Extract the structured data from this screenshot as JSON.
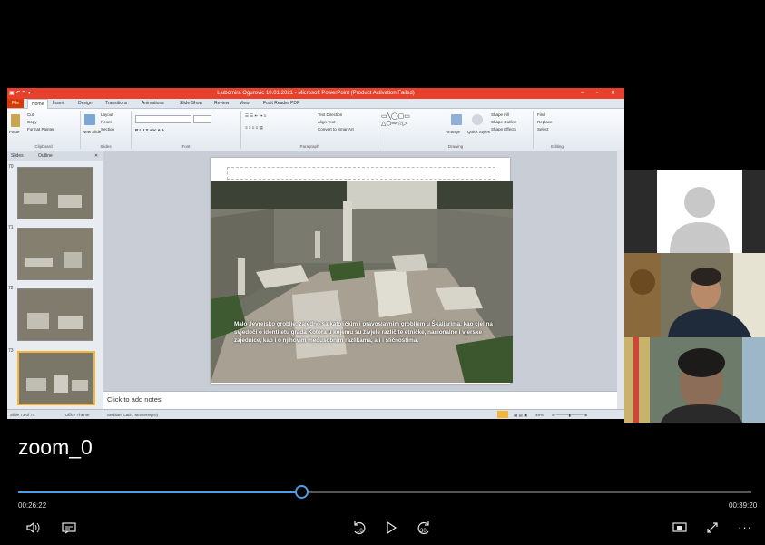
{
  "shared_screen": {
    "window_title": "Ljubomira Ogurovic 10.01.2021 - Microsoft PowerPoint (Product Activation Failed)",
    "ribbon_tabs": [
      "File",
      "Home",
      "Insert",
      "Design",
      "Transitions",
      "Animations",
      "Slide Show",
      "Review",
      "View",
      "Foxit Reader PDF"
    ],
    "clipboard": {
      "paste": "Paste",
      "cut": "Cut",
      "copy": "Copy",
      "format_painter": "Format Painter",
      "group": "Clipboard"
    },
    "slides_group": {
      "new_slide": "New Slide",
      "layout": "Layout",
      "reset": "Reset",
      "section": "Section",
      "group": "Slides"
    },
    "font_group": "Font",
    "paragraph_group": {
      "text_direction": "Text Direction",
      "align_text": "Align Text",
      "convert_smartart": "Convert to SmartArt",
      "group": "Paragraph"
    },
    "drawing_group": {
      "arrange": "Arrange",
      "quick_styles": "Quick Styles",
      "shape_fill": "Shape Fill",
      "shape_outline": "Shape Outline",
      "shape_effects": "Shape Effects",
      "group": "Drawing"
    },
    "editing_group": {
      "find": "Find",
      "replace": "Replace",
      "select": "Select",
      "group": "Editing"
    },
    "pane_tabs": [
      "Slides",
      "Outline"
    ],
    "thumb_numbers": [
      "70",
      "71",
      "72",
      "73"
    ],
    "slide_text": "Malo Jevrejsko groblje, zajedno sa katoličkim i pravoslavnim grobljem u Škaljarima, kao cjelina svjedoči o identitetu grada Kotora u kojemu su živjele različite etničke, nacionalne i vjerske zajednice, kao i o njihovim međusobnim razlikama, ali i sličnostima.",
    "notes_placeholder": "Click to add notes",
    "status": {
      "slide": "Slide 73 of 74",
      "theme": "\"Office Theme\"",
      "language": "Serbian (Latin, Montenegro)",
      "zoom": "49%"
    }
  },
  "player": {
    "meeting_title": "zoom_0",
    "current_time": "00:26:22",
    "total_time": "00:39:20",
    "progress": 0.3863
  },
  "colors": {
    "accent": "#4a9fe8",
    "ppt_title": "#e8402a"
  },
  "icons": {
    "volume": "volume-icon",
    "captions": "captions-icon",
    "rewind": "rewind-10-icon",
    "play": "play-icon",
    "forward": "forward-30-icon",
    "screen": "screen-icon",
    "expand": "expand-icon",
    "more": "more-icon"
  }
}
